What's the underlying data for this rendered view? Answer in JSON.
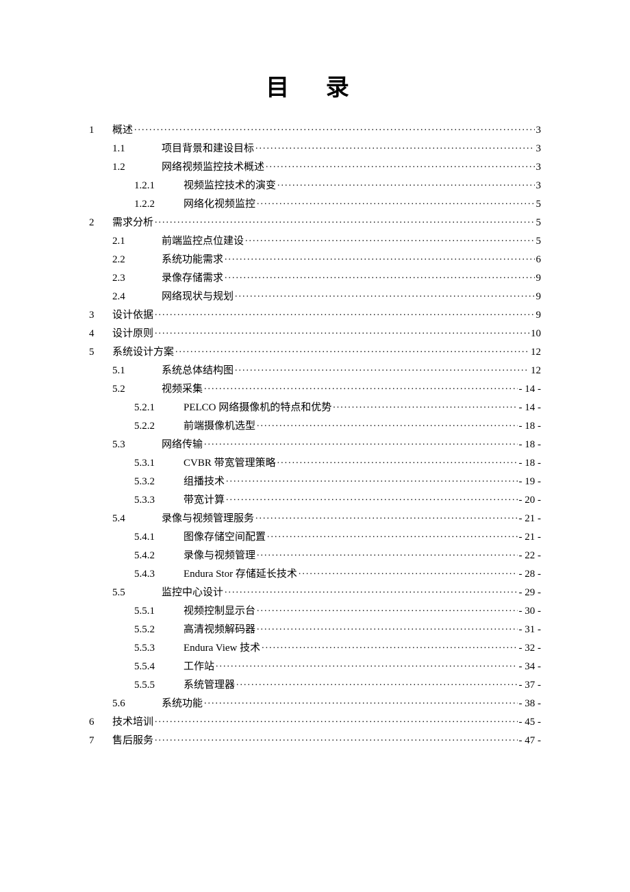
{
  "title": "目 录",
  "toc": [
    {
      "level": 0,
      "num": "1",
      "text": "概述",
      "page": "3"
    },
    {
      "level": 1,
      "num": "1.1",
      "text": "项目背景和建设目标",
      "page": "3"
    },
    {
      "level": 1,
      "num": "1.2",
      "text": "网络视频监控技术概述",
      "page": "3"
    },
    {
      "level": 2,
      "num": "1.2.1",
      "text": "视频监控技术的演变",
      "page": "3"
    },
    {
      "level": 2,
      "num": "1.2.2",
      "text": "网络化视频监控",
      "page": "5"
    },
    {
      "level": 0,
      "num": "2",
      "text": "需求分析",
      "page": "5"
    },
    {
      "level": 1,
      "num": "2.1",
      "text": "前端监控点位建设",
      "page": "5"
    },
    {
      "level": 1,
      "num": "2.2",
      "text": "系统功能需求",
      "page": "6"
    },
    {
      "level": 1,
      "num": "2.3",
      "text": "录像存储需求",
      "page": "9"
    },
    {
      "level": 1,
      "num": "2.4",
      "text": "网络现状与规划",
      "page": "9"
    },
    {
      "level": 0,
      "num": "3",
      "text": "设计依据",
      "page": "9"
    },
    {
      "level": 0,
      "num": "4",
      "text": "设计原则",
      "page": "10"
    },
    {
      "level": 0,
      "num": "5",
      "text": "系统设计方案",
      "page": "12"
    },
    {
      "level": 1,
      "num": "5.1",
      "text": "系统总体结构图",
      "page": "12"
    },
    {
      "level": 1,
      "num": "5.2",
      "text": "视频采集",
      "page": "- 14 -"
    },
    {
      "level": 2,
      "num": "5.2.1",
      "text": "PELCO 网络摄像机的特点和优势",
      "page": "- 14 -"
    },
    {
      "level": 2,
      "num": "5.2.2",
      "text": "前端摄像机选型",
      "page": "- 18 -"
    },
    {
      "level": 1,
      "num": "5.3",
      "text": "网络传输",
      "page": "- 18 -"
    },
    {
      "level": 2,
      "num": "5.3.1",
      "text": "CVBR 带宽管理策略",
      "page": "- 18 -"
    },
    {
      "level": 2,
      "num": "5.3.2",
      "text": "组播技术",
      "page": "- 19 -"
    },
    {
      "level": 2,
      "num": "5.3.3",
      "text": "带宽计算",
      "page": "- 20 -"
    },
    {
      "level": 1,
      "num": "5.4",
      "text": "录像与视频管理服务",
      "page": "- 21 -"
    },
    {
      "level": 2,
      "num": "5.4.1",
      "text": "图像存储空间配置",
      "page": "- 21 -"
    },
    {
      "level": 2,
      "num": "5.4.2",
      "text": "录像与视频管理",
      "page": "- 22 -"
    },
    {
      "level": 2,
      "num": "5.4.3",
      "text": "Endura Stor 存储延长技术",
      "page": "- 28 -"
    },
    {
      "level": 1,
      "num": "5.5",
      "text": "监控中心设计",
      "page": "- 29 -"
    },
    {
      "level": 2,
      "num": "5.5.1",
      "text": "视频控制显示台",
      "page": "- 30 -"
    },
    {
      "level": 2,
      "num": "5.5.2",
      "text": "高清视频解码器",
      "page": "- 31 -"
    },
    {
      "level": 2,
      "num": "5.5.3",
      "text": "Endura View 技术",
      "page": "- 32 -"
    },
    {
      "level": 2,
      "num": "5.5.4",
      "text": "工作站",
      "page": "- 34 -"
    },
    {
      "level": 2,
      "num": "5.5.5",
      "text": "系统管理器",
      "page": "- 37 -"
    },
    {
      "level": 1,
      "num": "5.6",
      "text": "系统功能",
      "page": "- 38 -"
    },
    {
      "level": 0,
      "num": "6",
      "text": "技术培训",
      "page": "- 45 -"
    },
    {
      "level": 0,
      "num": "7",
      "text": "售后服务",
      "page": "- 47 -"
    }
  ]
}
